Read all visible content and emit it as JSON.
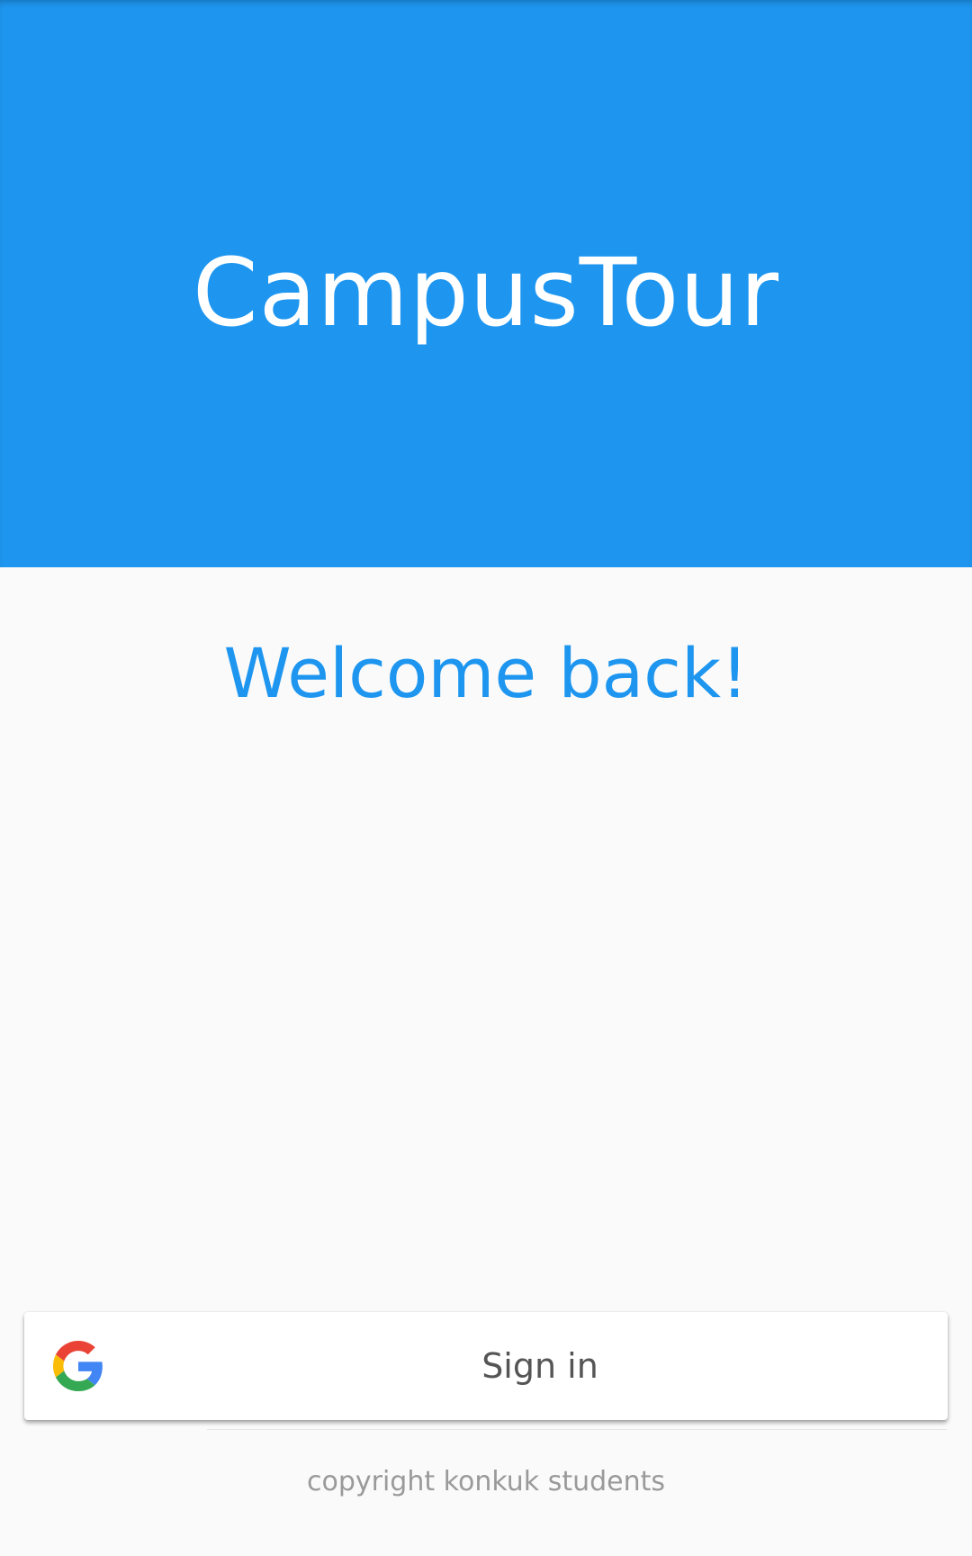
{
  "header": {
    "title": "CampusTour",
    "background_color": "#1e96f0"
  },
  "main": {
    "welcome_text": "Welcome back!"
  },
  "signin_button": {
    "label": "Sign in",
    "icon": "google-g-icon"
  },
  "footer": {
    "copyright": "copyright konkuk students"
  }
}
